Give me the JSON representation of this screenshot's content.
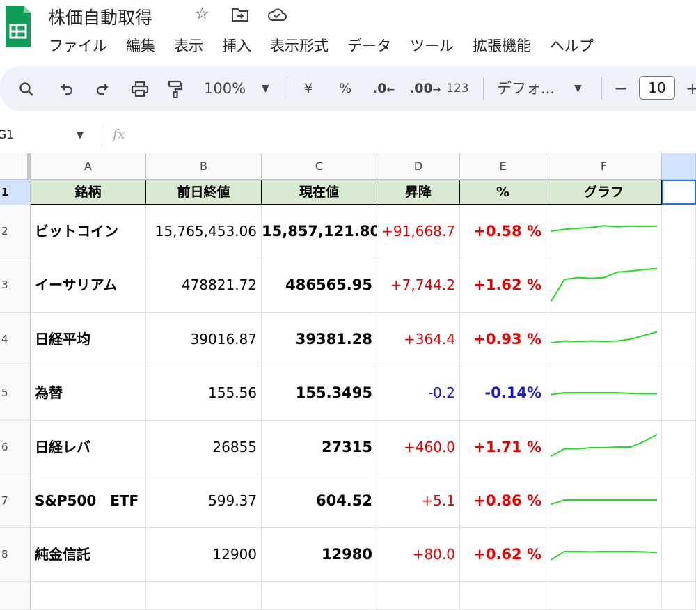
{
  "app": {
    "title": "株価自動取得",
    "menu": [
      "ファイル",
      "編集",
      "表示",
      "挿入",
      "表示形式",
      "データ",
      "ツール",
      "拡張機能",
      "ヘルプ"
    ]
  },
  "toolbar": {
    "zoom": "100%",
    "currency": "¥",
    "percent": "%",
    "dec_decrease": ".0",
    "dec_increase": ".00",
    "format_number": "123",
    "font": "デフォ...",
    "font_size": "10"
  },
  "formula_bar": {
    "cell_ref": "G1",
    "fx": "fx"
  },
  "sheet": {
    "columns": [
      "A",
      "B",
      "C",
      "D",
      "E",
      "F"
    ],
    "row_numbers": [
      "1",
      "2",
      "3",
      "4",
      "5",
      "6",
      "7",
      "8"
    ],
    "headers": [
      "銘柄",
      "前日終値",
      "現在値",
      "昇降",
      "%",
      "グラフ"
    ],
    "rows": [
      {
        "name": "ビットコイン",
        "prev": "15,765,453.06",
        "current": "15,857,121.80",
        "change": "+91,668.7",
        "pct": "+0.58 %",
        "dir": "pos",
        "spark": [
          0.5,
          0.45,
          0.42,
          0.4,
          0.35,
          0.38,
          0.36,
          0.37,
          0.36
        ]
      },
      {
        "name": "イーサリアム",
        "prev": "478821.72",
        "current": "486565.95",
        "change": "+7,744.2",
        "pct": "+1.62 %",
        "dir": "pos",
        "spark": [
          0.95,
          0.35,
          0.3,
          0.32,
          0.3,
          0.15,
          0.12,
          0.08,
          0.05
        ]
      },
      {
        "name": "日経平均",
        "prev": "39016.87",
        "current": "39381.28",
        "change": "+364.4",
        "pct": "+0.93 %",
        "dir": "pos",
        "spark": [
          0.6,
          0.55,
          0.56,
          0.55,
          0.56,
          0.55,
          0.5,
          0.4,
          0.3
        ]
      },
      {
        "name": "為替",
        "prev": "155.56",
        "current": "155.3495",
        "change": "-0.2",
        "pct": "-0.14%",
        "dir": "neg",
        "spark": [
          0.55,
          0.5,
          0.5,
          0.5,
          0.5,
          0.5,
          0.52,
          0.53,
          0.53
        ]
      },
      {
        "name": "日経レバ",
        "prev": "26855",
        "current": "27315",
        "change": "+460.0",
        "pct": "+1.71 %",
        "dir": "pos",
        "spark": [
          0.75,
          0.55,
          0.55,
          0.52,
          0.52,
          0.5,
          0.5,
          0.35,
          0.15
        ]
      },
      {
        "name": "S&P500　ETF",
        "prev": "599.37",
        "current": "604.52",
        "change": "+5.1",
        "pct": "+0.86 %",
        "dir": "pos",
        "spark": [
          0.6,
          0.48,
          0.48,
          0.48,
          0.48,
          0.48,
          0.48,
          0.48,
          0.48
        ]
      },
      {
        "name": "純金信託",
        "prev": "12900",
        "current": "12980",
        "change": "+80.0",
        "pct": "+0.62 %",
        "dir": "pos",
        "spark": [
          0.65,
          0.42,
          0.42,
          0.43,
          0.42,
          0.42,
          0.42,
          0.43,
          0.45
        ]
      }
    ]
  },
  "colors": {
    "header_bg": "#d9ead3",
    "positive": "#e60000",
    "negative": "#1a1ad6",
    "sparkline": "#22dd22",
    "toolbar_bg": "#edf2fa"
  }
}
